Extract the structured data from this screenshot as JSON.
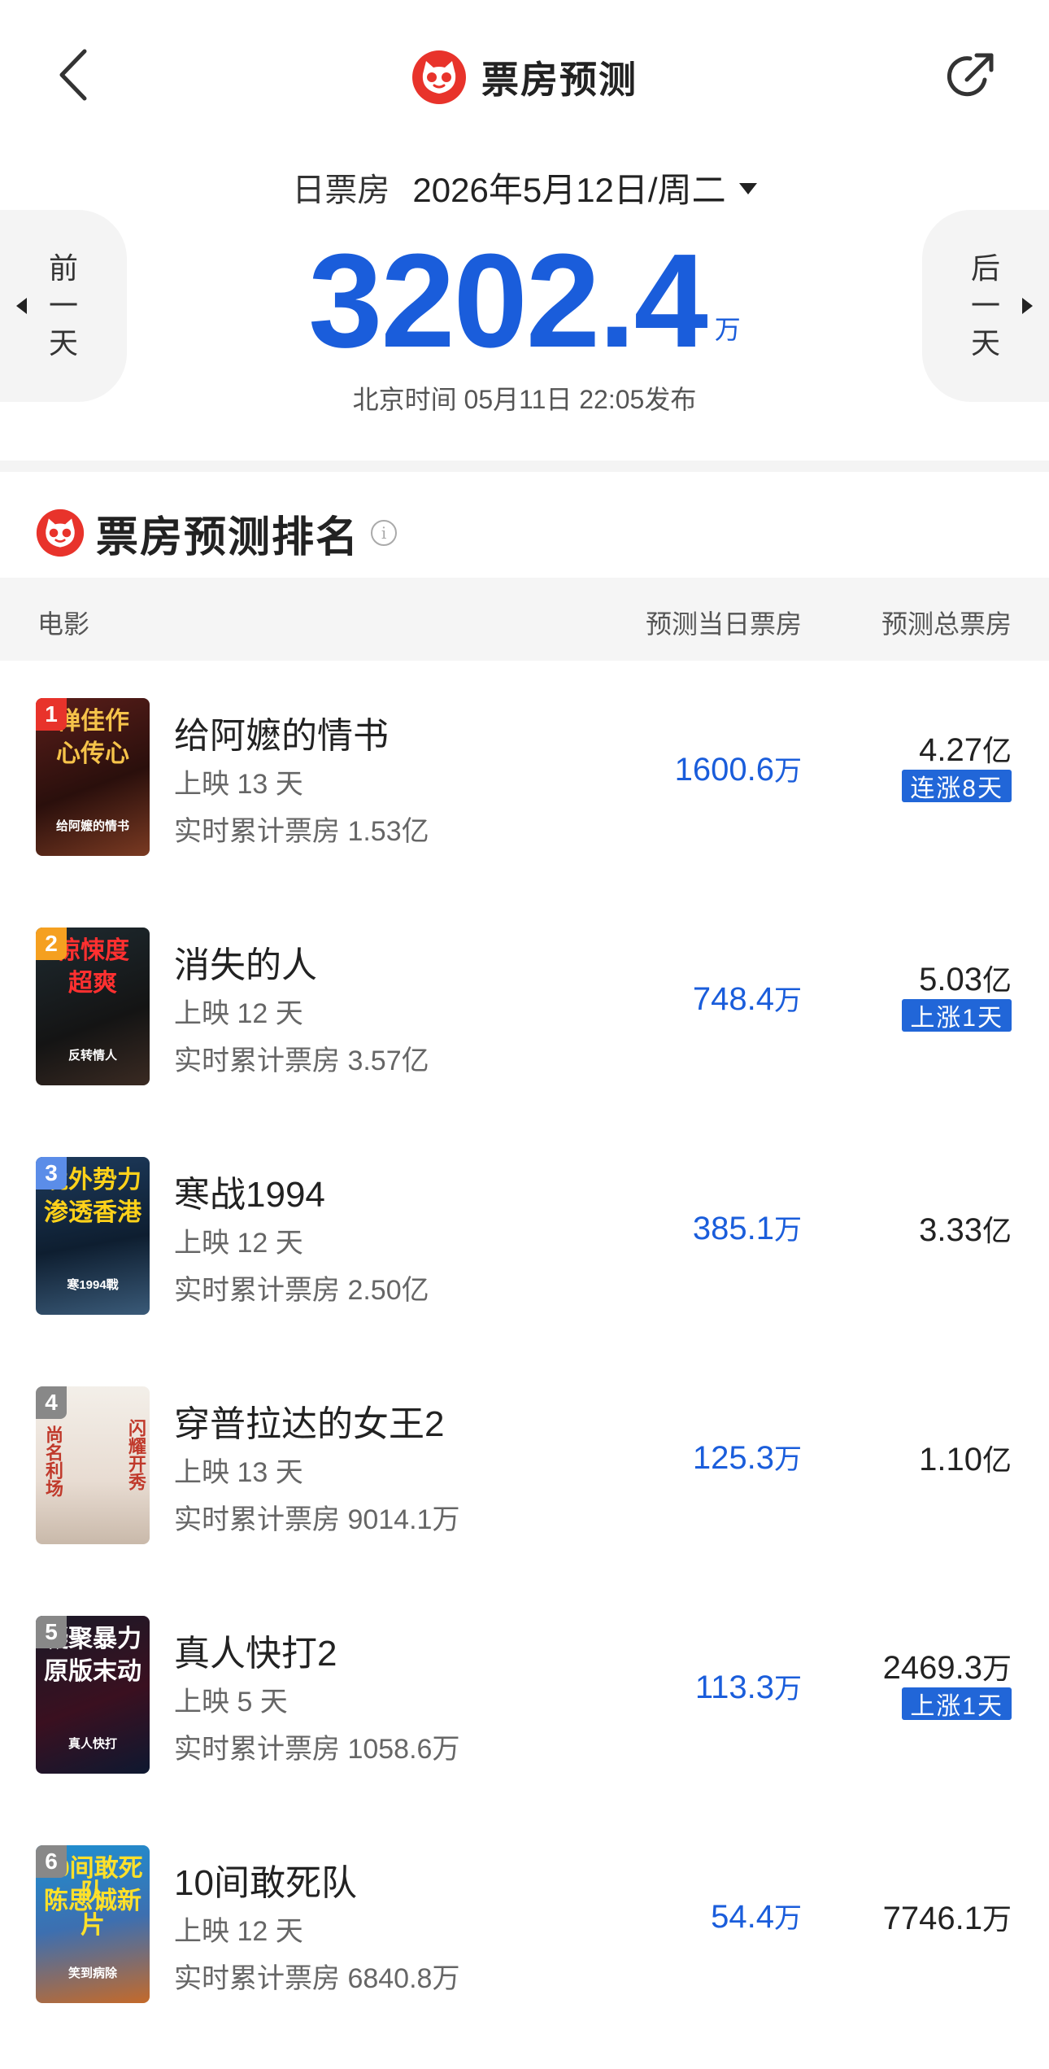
{
  "header": {
    "title": "票房预测"
  },
  "date": {
    "label": "日票房",
    "value": "2026年5月12日/周二"
  },
  "nav": {
    "prev": [
      "前",
      "一",
      "天"
    ],
    "next": [
      "后",
      "一",
      "天"
    ]
  },
  "total": {
    "value": "3202.4",
    "unit": "万",
    "publish": "北京时间  05月11日  22:05发布"
  },
  "ranking": {
    "title": "票房预测排名",
    "info_glyph": "i",
    "columns": {
      "movie": "电影",
      "day": "预测当日票房",
      "total": "预测总票房"
    },
    "movies": [
      {
        "rank": "1",
        "title": "给阿嬷的情书",
        "days": "上映 13 天",
        "cumulative": "实时累计票房 1.53亿",
        "day_value": "1600.6",
        "day_unit": "万",
        "total_value": "4.27",
        "total_unit": "亿",
        "tag": "连涨8天",
        "poster_text": [
          "惮佳作",
          "心传心",
          "给阿嬷的情书"
        ]
      },
      {
        "rank": "2",
        "title": "消失的人",
        "days": "上映 12 天",
        "cumulative": "实时累计票房 3.57亿",
        "day_value": "748.4",
        "day_unit": "万",
        "total_value": "5.03",
        "total_unit": "亿",
        "tag": "上涨1天",
        "poster_text": [
          "惊悚度",
          "超爽",
          "反转情人"
        ]
      },
      {
        "rank": "3",
        "title": "寒战1994",
        "days": "上映 12 天",
        "cumulative": "实时累计票房 2.50亿",
        "day_value": "385.1",
        "day_unit": "万",
        "total_value": "3.33",
        "total_unit": "亿",
        "tag": "",
        "poster_text": [
          "境外势力",
          "渗透香港",
          "寒1994戰"
        ]
      },
      {
        "rank": "4",
        "title": "穿普拉达的女王2",
        "days": "上映 13 天",
        "cumulative": "实时累计票房 9014.1万",
        "day_value": "125.3",
        "day_unit": "万",
        "total_value": "1.10",
        "total_unit": "亿",
        "tag": "",
        "poster_text": [
          "尚名利场",
          "闪耀开秀"
        ]
      },
      {
        "rank": "5",
        "title": "真人快打2",
        "days": "上映 5 天",
        "cumulative": "实时累计票房 1058.6万",
        "day_value": "113.3",
        "day_unit": "万",
        "total_value": "2469.3",
        "total_unit": "万",
        "tag": "上涨1天",
        "poster_text": [
          "凝聚暴力",
          "原版末动",
          "真人快打"
        ]
      },
      {
        "rank": "6",
        "title": "10间敢死队",
        "days": "上映 12 天",
        "cumulative": "实时累计票房 6840.8万",
        "day_value": "54.4",
        "day_unit": "万",
        "total_value": "7746.1",
        "total_unit": "万",
        "tag": "",
        "poster_text": [
          "10间敢死队",
          "陈思诚新片",
          "笑到病除"
        ]
      }
    ]
  },
  "colors": {
    "accent": "#1a5ddb",
    "tag": "#2166d8",
    "logo_red": "#e8332b",
    "badge_colors": [
      "#e8332b",
      "#f5a020",
      "#5b8de8",
      "#888888",
      "#888888",
      "#888888"
    ]
  },
  "icons": {
    "back": "chevron-left-icon",
    "share": "share-icon",
    "logo": "maoyan-cat-icon",
    "info": "info-icon"
  }
}
